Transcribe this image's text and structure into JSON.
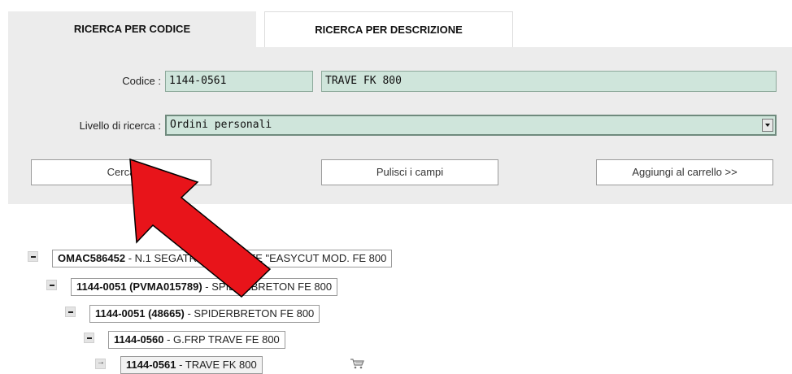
{
  "tabs": [
    {
      "label": "RICERCA PER CODICE"
    },
    {
      "label": "RICERCA PER DESCRIZIONE"
    }
  ],
  "form": {
    "code_label": "Codice :",
    "code_value": "1144-0561",
    "description_value": "TRAVE FK 800",
    "level_label": "Livello di ricerca :",
    "level_value": "Ordini personali"
  },
  "buttons": {
    "search": "Cerca",
    "clear": "Pulisci i campi",
    "add_to_cart": "Aggiungi al carrello >>"
  },
  "tree": [
    {
      "code": "OMAC586452",
      "desc": " - N.1 SEGATRICE A PONTE \"EASYCUT MOD. FE 800"
    },
    {
      "code": "1144-0051 (PVMA015789)",
      "desc": " - SPIDERBRETON FE 800"
    },
    {
      "code": "1144-0051 (48665)",
      "desc": " - SPIDERBRETON FE 800"
    },
    {
      "code": "1144-0560",
      "desc": " - G.FRP TRAVE FE 800"
    },
    {
      "code": "1144-0561",
      "desc": " - TRAVE FK 800"
    }
  ],
  "colors": {
    "panel_bg": "#ececec",
    "field_bg": "#cfe5db",
    "arrow": "#e8141a"
  },
  "icons": [
    "minus-icon",
    "expand-arrow-icon",
    "cart-icon",
    "dropdown-arrow-icon",
    "red-pointer-arrow"
  ]
}
